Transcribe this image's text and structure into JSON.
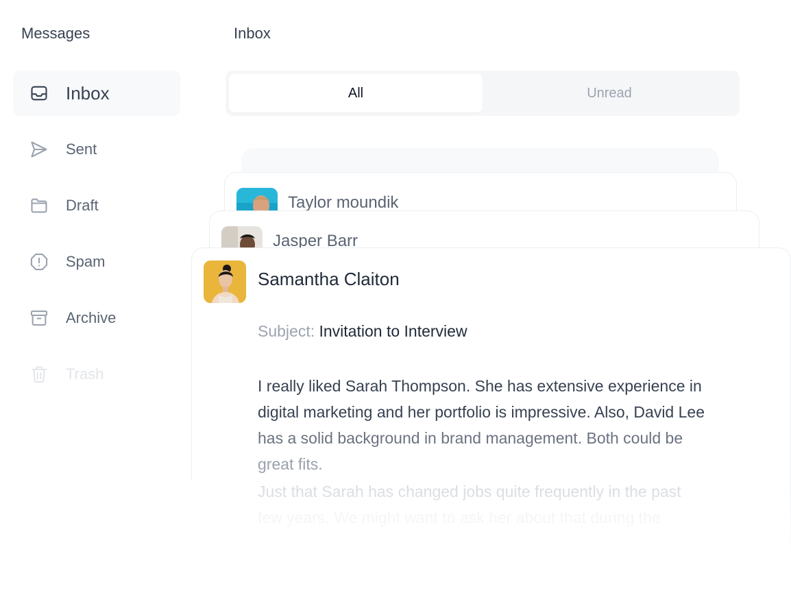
{
  "sidebar": {
    "title": "Messages",
    "items": [
      {
        "label": "Inbox",
        "icon": "inbox-icon",
        "active": true
      },
      {
        "label": "Sent",
        "icon": "send-icon",
        "active": false
      },
      {
        "label": "Draft",
        "icon": "folder-icon",
        "active": false
      },
      {
        "label": "Spam",
        "icon": "alert-octagon-icon",
        "active": false
      },
      {
        "label": "Archive",
        "icon": "archive-icon",
        "active": false
      },
      {
        "label": "Trash",
        "icon": "trash-icon",
        "active": false
      }
    ]
  },
  "main": {
    "title": "Inbox",
    "tabs": [
      {
        "label": "All",
        "active": true
      },
      {
        "label": "Unread",
        "active": false
      }
    ]
  },
  "messages": [
    {
      "sender": "Taylor moundik",
      "avatar": "avatar-taylor"
    },
    {
      "sender": "Jasper Barr",
      "avatar": "avatar-jasper"
    },
    {
      "sender": "Samantha Claiton",
      "avatar": "avatar-samantha",
      "subject_label": "Subject:",
      "subject": "Invitation to Interview",
      "body_lines": [
        "I really liked Sarah Thompson. She has extensive experience in",
        "digital marketing and her portfolio is impressive. Also, David Lee",
        "has a solid background in brand management. Both could be",
        "great fits.",
        "Just that Sarah has changed jobs quite frequently in the past",
        "few years. We might want to ask her about that during the"
      ]
    }
  ],
  "colors": {
    "active_bg": "#f8f9fb",
    "tabs_bg": "#f5f6f8",
    "text_dark": "#1f2937",
    "text_muted": "#9ca3af",
    "avatar_taylor_bg": "#1aa3c9",
    "avatar_samantha_bg": "#e9b53a"
  }
}
